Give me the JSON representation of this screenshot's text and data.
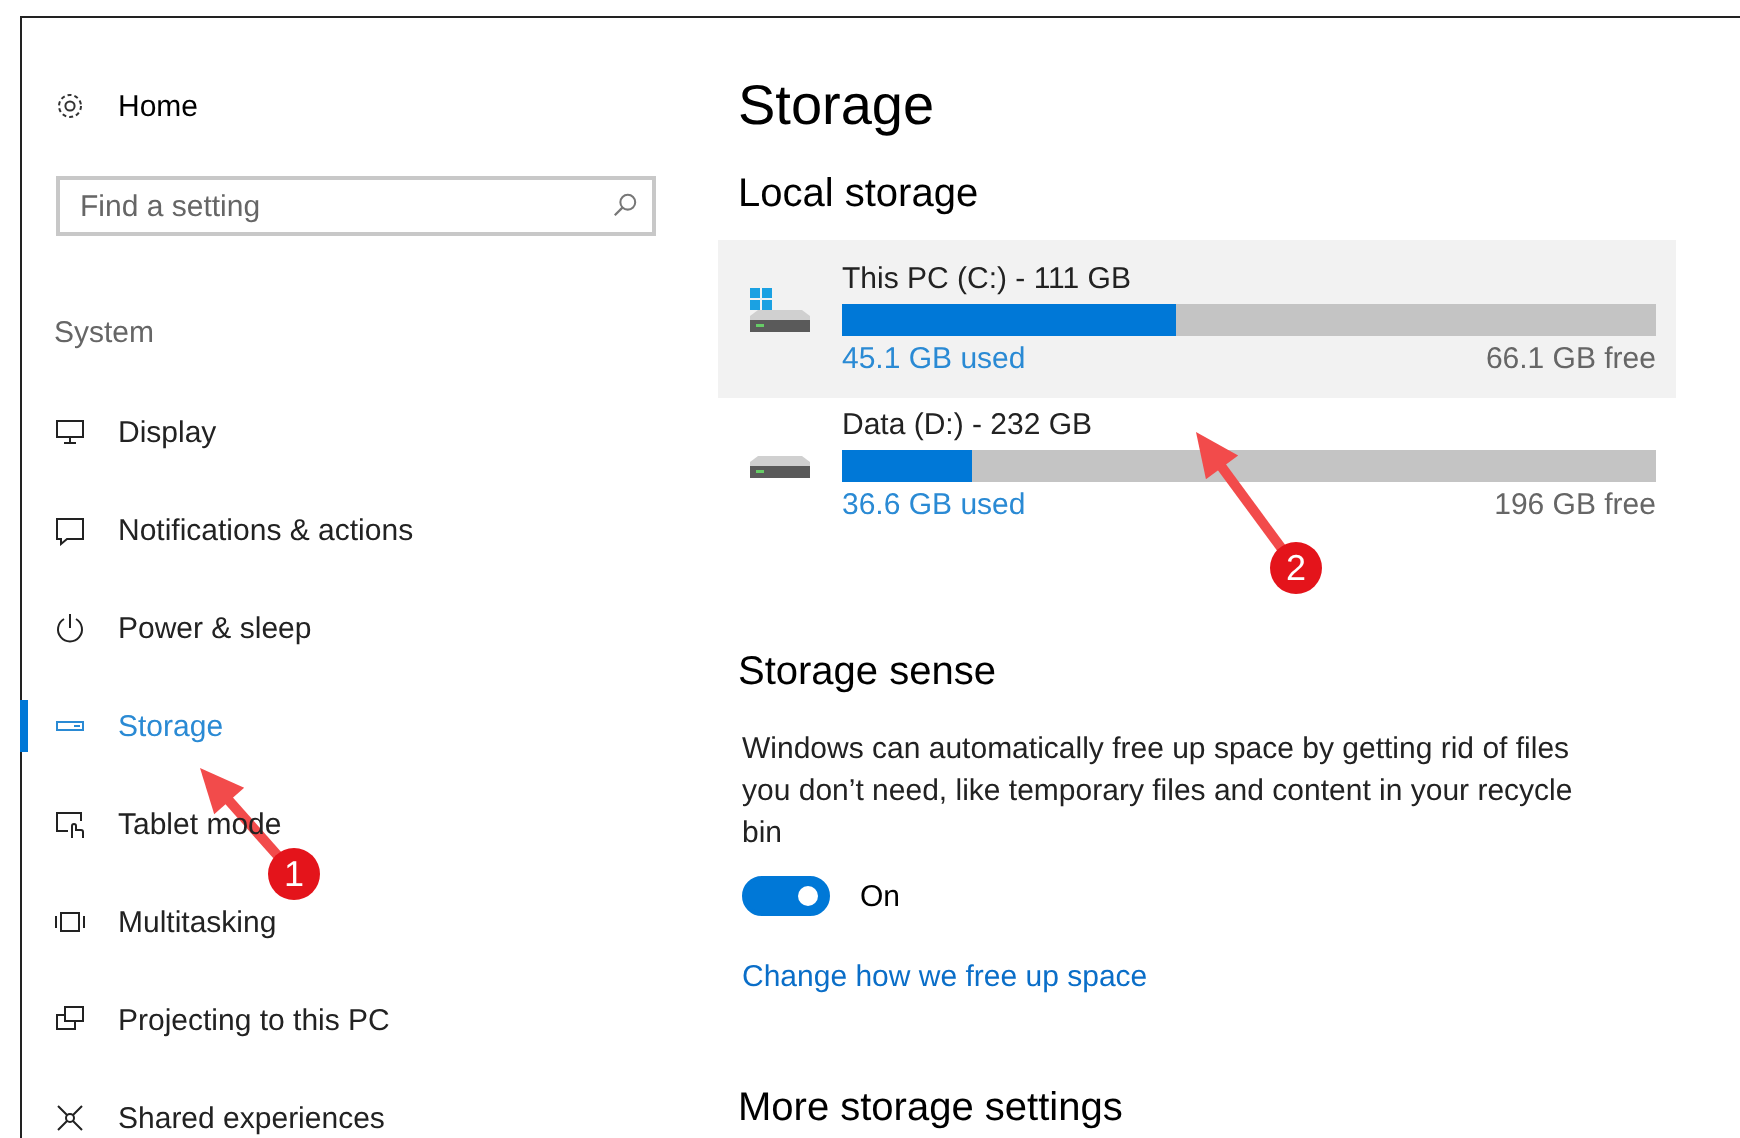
{
  "sidebar": {
    "home": "Home",
    "search": {
      "placeholder": "Find a setting"
    },
    "section": "System",
    "items": [
      {
        "label": "Display",
        "selected": false
      },
      {
        "label": "Notifications & actions",
        "selected": false
      },
      {
        "label": "Power & sleep",
        "selected": false
      },
      {
        "label": "Storage",
        "selected": true
      },
      {
        "label": "Tablet mode",
        "selected": false
      },
      {
        "label": "Multitasking",
        "selected": false
      },
      {
        "label": "Projecting to this PC",
        "selected": false
      },
      {
        "label": "Shared experiences",
        "selected": false
      }
    ]
  },
  "main": {
    "title": "Storage",
    "local_storage": {
      "heading": "Local storage",
      "drives": [
        {
          "name": "This PC (C:) - 111 GB",
          "system": true,
          "highlighted": true,
          "level": 0.41,
          "used": "45.1 GB used",
          "free": "66.1 GB free"
        },
        {
          "name": "Data (D:) - 232 GB",
          "system": false,
          "highlighted": false,
          "level": 0.16,
          "used": "36.6 GB used",
          "free": "196 GB free"
        }
      ]
    },
    "storage_sense": {
      "heading": "Storage sense",
      "description": "Windows can automatically free up space by getting rid of files you don’t need, like temporary files and content in your recycle bin",
      "toggle": {
        "on": true,
        "label": "On"
      },
      "link": "Change how we free up space"
    },
    "more_heading": "More storage settings"
  },
  "annotations": [
    {
      "label": "1"
    },
    {
      "label": "2"
    }
  ]
}
